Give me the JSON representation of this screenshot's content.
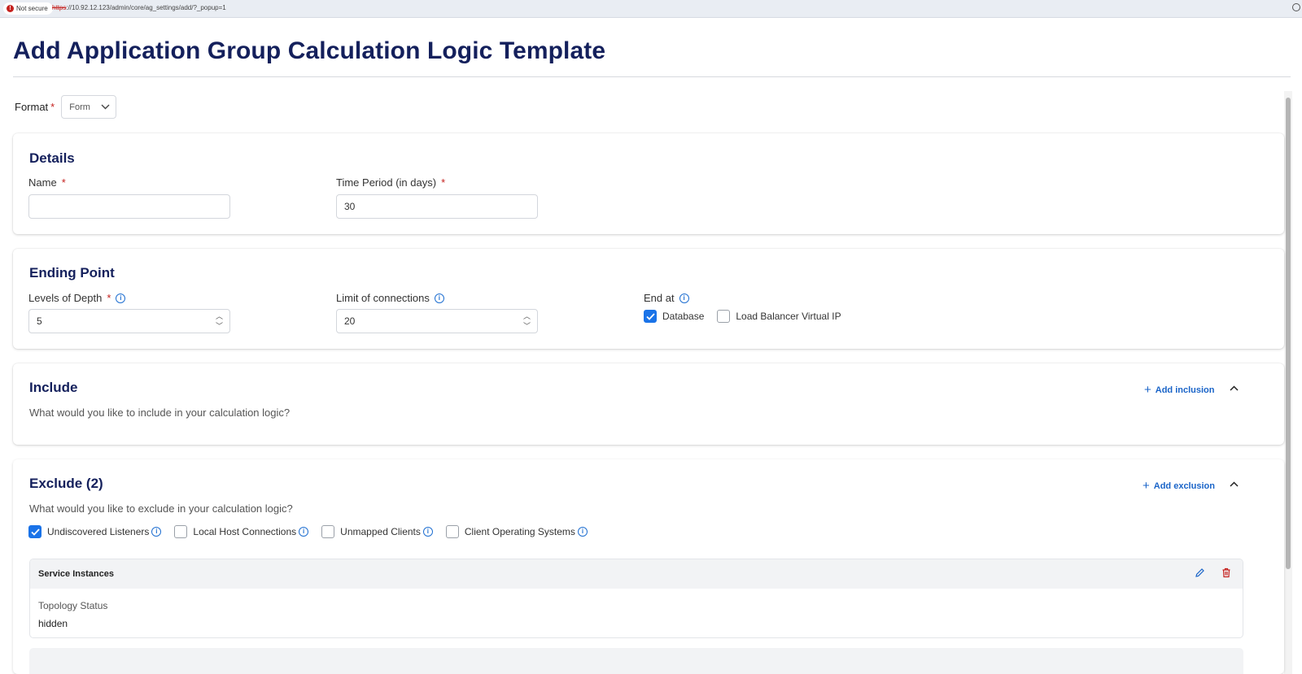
{
  "browser": {
    "security_label": "Not secure",
    "url_scheme": "https",
    "url_rest": "://10.92.12.123/admin/core/ag_settings/add/?_popup=1"
  },
  "page": {
    "title": "Add Application Group Calculation Logic Template"
  },
  "format": {
    "label": "Format",
    "required_mark": "*",
    "value": "Form"
  },
  "details": {
    "title": "Details",
    "name_label": "Name",
    "name_value": "",
    "time_period_label": "Time Period (in days)",
    "time_period_value": "30",
    "required_mark": "*"
  },
  "ending_point": {
    "title": "Ending Point",
    "levels_label": "Levels of Depth",
    "levels_value": "5",
    "limit_label": "Limit of connections",
    "limit_value": "20",
    "end_at_label": "End at",
    "required_mark": "*",
    "options": [
      {
        "label": "Database",
        "checked": true
      },
      {
        "label": "Load Balancer Virtual IP",
        "checked": false
      }
    ]
  },
  "include": {
    "title": "Include",
    "subtitle": "What would you like to include in your calculation logic?",
    "add_label": "Add inclusion"
  },
  "exclude": {
    "title": "Exclude (2)",
    "subtitle": "What would you like to exclude in your calculation logic?",
    "add_label": "Add exclusion",
    "options": [
      {
        "label": "Undiscovered Listeners",
        "checked": true
      },
      {
        "label": "Local Host Connections",
        "checked": false
      },
      {
        "label": "Unmapped Clients",
        "checked": false
      },
      {
        "label": "Client Operating Systems",
        "checked": false
      }
    ],
    "rule": {
      "title": "Service Instances",
      "field_label": "Topology Status",
      "field_value": "hidden"
    }
  },
  "colors": {
    "accent": "#1a73e8",
    "heading": "#14205c",
    "danger": "#c5221f"
  }
}
